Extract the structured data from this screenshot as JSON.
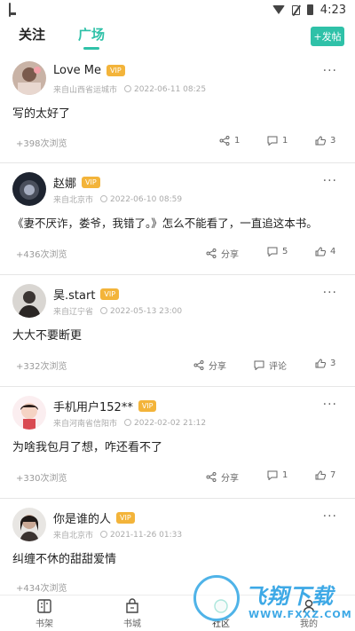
{
  "status_bar": {
    "time": "4:23"
  },
  "header": {
    "tabs": [
      {
        "label": "关注",
        "active": false
      },
      {
        "label": "广场",
        "active": true
      }
    ],
    "post_button": "+发帖",
    "accent_color": "#2fc1a8"
  },
  "posts": [
    {
      "username": "Love Me",
      "vip": "VIP",
      "location": "来自山西省运城市",
      "time": "2022-06-11 08:25",
      "content": "写的太好了",
      "views": "+398次浏览",
      "share": "1",
      "comment": "1",
      "like": "3"
    },
    {
      "username": "赵娜",
      "vip": "VIP",
      "location": "来自北京市",
      "time": "2022-06-10 08:59",
      "content": "《妻不厌诈，娄爷，我错了。》怎么不能看了，一直追这本书。",
      "views": "+436次浏览",
      "share": "分享",
      "comment": "5",
      "like": "4"
    },
    {
      "username": "昊.start",
      "vip": "VIP",
      "location": "来自辽宁省",
      "time": "2022-05-13 23:00",
      "content": "大大不要断更",
      "views": "+332次浏览",
      "share": "分享",
      "comment": "评论",
      "like": "3"
    },
    {
      "username": "手机用户152**",
      "vip": "VIP",
      "location": "来自河南省信阳市",
      "time": "2022-02-02 21:12",
      "content": "为啥我包月了想，咋还看不了",
      "views": "+330次浏览",
      "share": "分享",
      "comment": "1",
      "like": "7"
    },
    {
      "username": "你是谁的人",
      "vip": "VIP",
      "location": "来自北京市",
      "time": "2021-11-26 01:33",
      "content": "纠缠不休的甜甜爱情",
      "views": "+434次浏览"
    }
  ],
  "bottom_nav": [
    {
      "label": "书架",
      "icon": "bookshelf-icon"
    },
    {
      "label": "书城",
      "icon": "store-icon"
    },
    {
      "label": "社区",
      "icon": "community-icon",
      "active": true
    },
    {
      "label": "我的",
      "icon": "profile-icon"
    }
  ],
  "watermark": {
    "title": "飞翔下载",
    "url": "WWW.FXXZ.COM"
  }
}
